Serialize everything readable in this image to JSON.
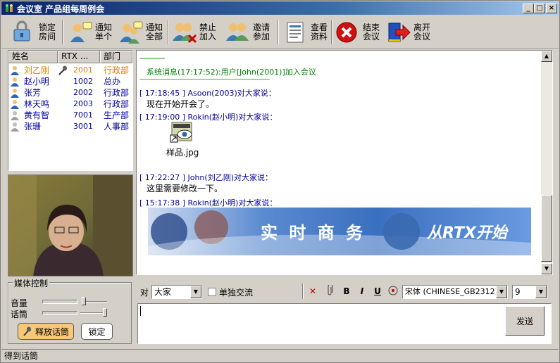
{
  "window": {
    "title": "会议室  产品组每周例会",
    "min": "_",
    "max": "□",
    "close": "×"
  },
  "toolbar": [
    {
      "label": "锁定房间",
      "icon": "lock-room-icon"
    },
    {
      "label": "通知单个",
      "icon": "notify-one-icon"
    },
    {
      "label": "通知全部",
      "icon": "notify-all-icon"
    },
    {
      "label": "禁止加入",
      "icon": "forbid-join-icon"
    },
    {
      "label": "邀请参加",
      "icon": "invite-icon"
    },
    {
      "label": "查看资料",
      "icon": "view-info-icon"
    },
    {
      "label": "结束会议",
      "icon": "end-meeting-icon"
    },
    {
      "label": "离开会议",
      "icon": "leave-meeting-icon"
    }
  ],
  "members": {
    "headers": [
      "姓名",
      "RTX ...",
      "部门"
    ],
    "rows": [
      {
        "name": "刘乙刚",
        "rtx": "2001",
        "dept": "行政部",
        "color": "#e08000",
        "speaking": true
      },
      {
        "name": "赵小明",
        "rtx": "1002",
        "dept": "总办",
        "color": "#0000a0"
      },
      {
        "name": "张芳",
        "rtx": "2002",
        "dept": "行政部",
        "color": "#0000a0"
      },
      {
        "name": "林天鸣",
        "rtx": "2003",
        "dept": "行政部",
        "color": "#0000a0"
      },
      {
        "name": "黄有智",
        "rtx": "7001",
        "dept": "生产部",
        "color": "#0000a0"
      },
      {
        "name": "张珊",
        "rtx": "3001",
        "dept": "人事部",
        "color": "#0000a0"
      }
    ]
  },
  "media": {
    "legend": "媒体控制",
    "volume_label": "音量",
    "mic_label": "话筒",
    "release_button": "释放话筒",
    "lock_button": "锁定"
  },
  "chat": {
    "dashes": "------------",
    "system_msg": "系统消息(17:17:52):用户[John(2001)]加入会议",
    "dashes_long": "----------------------------------------------------------------------------------",
    "messages": [
      {
        "time": "[ 17:18:45 ]",
        "who": "Asoon(2003)对大家说：",
        "text": "现在开始开会了。"
      },
      {
        "time": "[ 17:19:00 ]",
        "who": "Rokin(赵小明)对大家说：",
        "file": "样品.jpg"
      },
      {
        "time": "[ 17:22:27 ]",
        "who": "John(刘乙刚)对大家说：",
        "text": "这里需要修改一下。"
      },
      {
        "time": "[ 15:17:38 ]",
        "who": "Rokin(赵小明)对大家说：",
        "banner": "实 时 商 务",
        "banner2": "从RTX开始"
      }
    ]
  },
  "compose": {
    "to_label": "对",
    "to_value": "大家",
    "private_label": "单独交流",
    "font_value": "宋体 (CHINESE_GB2312)",
    "size_value": "9",
    "send_button": "发送"
  },
  "status": "得到话筒"
}
